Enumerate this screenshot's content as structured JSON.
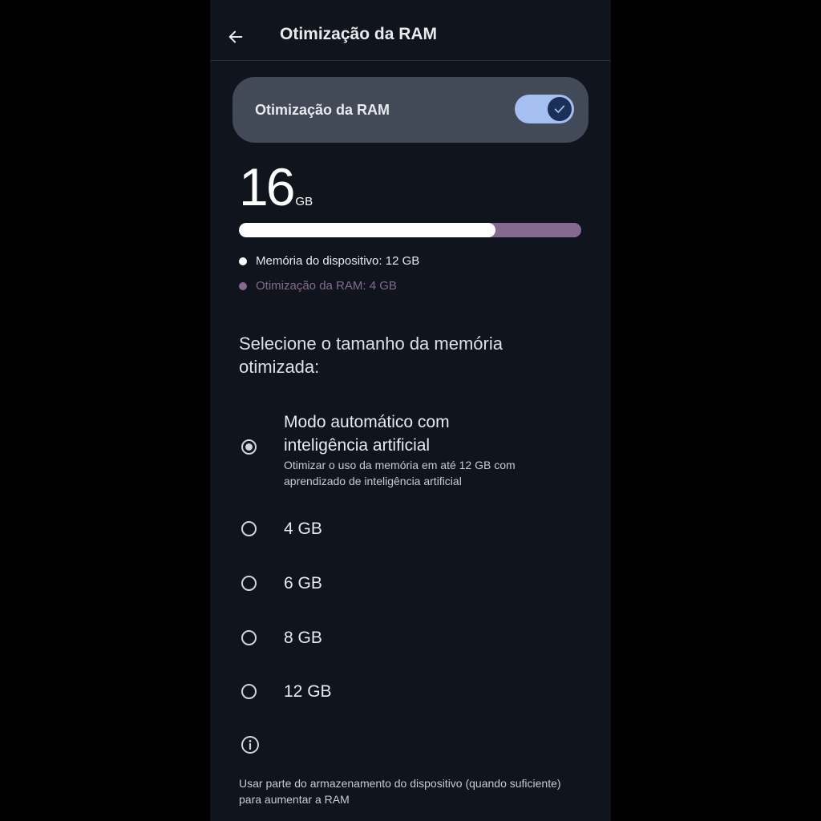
{
  "header": {
    "title": "Otimização da RAM"
  },
  "toggle": {
    "label": "Otimização da RAM",
    "enabled": true
  },
  "memory": {
    "total_value": "16",
    "total_unit": "GB",
    "device_fraction": 0.75,
    "legend": [
      {
        "label": "Memória do dispositivo: 12 GB",
        "color": "#ffffff"
      },
      {
        "label": "Otimização da RAM: 4 GB",
        "color": "#86698e"
      }
    ]
  },
  "selection": {
    "heading": "Selecione o tamanho da memória otimizada:",
    "auto_option": {
      "title": "Modo automático com inteligência artificial",
      "description": "Otimizar o uso da memória em até 12 GB com aprendizado de inteligência artificial",
      "selected": true
    },
    "options": [
      {
        "label": "4 GB",
        "selected": false
      },
      {
        "label": "6 GB",
        "selected": false
      },
      {
        "label": "8 GB",
        "selected": false
      },
      {
        "label": "12 GB",
        "selected": false
      }
    ]
  },
  "footer": {
    "text": "Usar parte do armazenamento do dispositivo (quando suficiente) para aumentar a RAM"
  },
  "icons": {
    "back": "arrow-left-icon",
    "check": "check-icon",
    "info": "info-icon"
  }
}
